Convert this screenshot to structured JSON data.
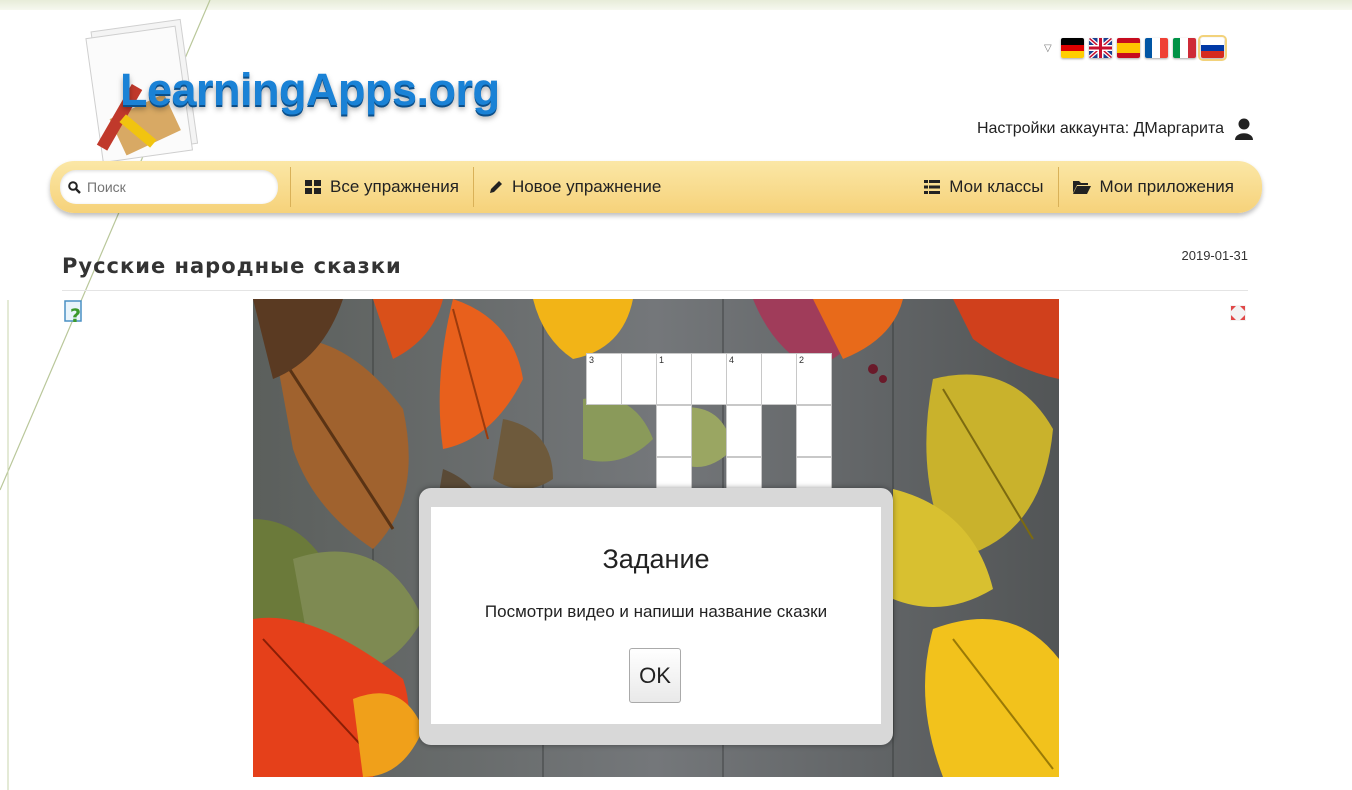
{
  "logo": {
    "text": "LearningApps.org"
  },
  "languages": [
    {
      "name": "de",
      "selected": false
    },
    {
      "name": "en",
      "selected": false
    },
    {
      "name": "es",
      "selected": false
    },
    {
      "name": "fr",
      "selected": false
    },
    {
      "name": "it",
      "selected": false
    },
    {
      "name": "ru",
      "selected": true
    }
  ],
  "account": {
    "label": "Настройки аккаунта: ДМаргарита"
  },
  "nav": {
    "search_placeholder": "Поиск",
    "all_exercises": "Все упражнения",
    "new_exercise": "Новое упражнение",
    "my_classes": "Мои классы",
    "my_apps": "Мои приложения"
  },
  "page": {
    "title": "Русские народные сказки",
    "date": "2019-01-31"
  },
  "crossword": {
    "numbers": [
      "3",
      "1",
      "4",
      "2"
    ]
  },
  "dialog": {
    "title": "Задание",
    "text": "Посмотри видео и напиши название сказки",
    "ok": "OK"
  },
  "colors": {
    "accent": "#1a82d6",
    "navbar": "#f6d27a"
  }
}
